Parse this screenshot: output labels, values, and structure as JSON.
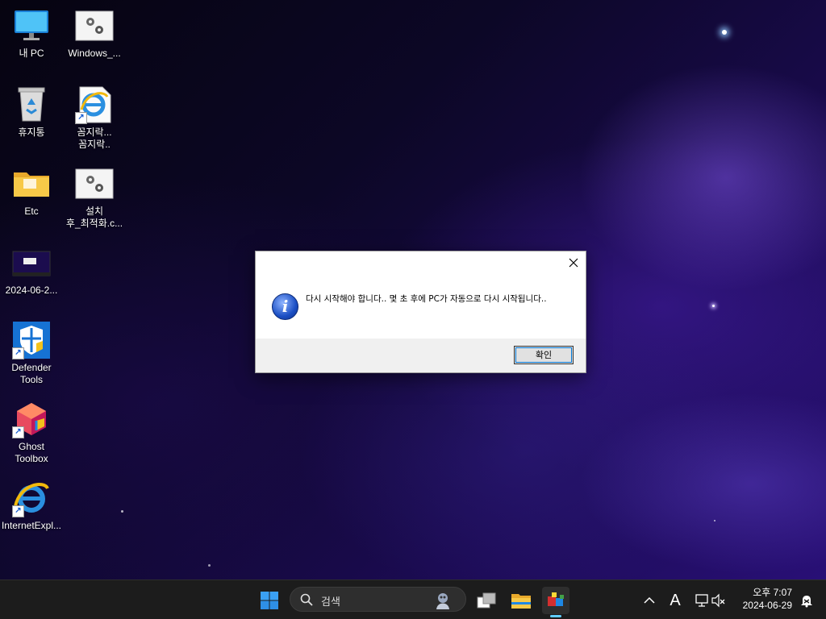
{
  "desktop": {
    "icons": [
      {
        "label": "내 PC"
      },
      {
        "label": "Windows_..."
      },
      {
        "label": "휴지통"
      },
      {
        "label": "꼼지락...\n꼼지락.."
      },
      {
        "label": "Etc"
      },
      {
        "label": "설치\n후_최적화.c..."
      },
      {
        "label": "2024-06-2..."
      },
      {
        "label": "Defender\nTools"
      },
      {
        "label": "Ghost\nToolbox"
      },
      {
        "label": "InternetExpl..."
      }
    ]
  },
  "dialog": {
    "message": "다시 시작해야 합니다.. 몇 초 후에 PC가 자동으로 다시 시작됩니다..",
    "ok_label": "확인",
    "close_icon": "close-icon",
    "info_icon": "info-icon"
  },
  "taskbar": {
    "search_placeholder": "검색",
    "time": "오후 7:07",
    "date": "2024-06-29",
    "language_indicator": "A"
  },
  "colors": {
    "taskbar_bg": "#1c1c1c",
    "dialog_footer": "#f0f0f0",
    "accent": "#0078d7"
  }
}
